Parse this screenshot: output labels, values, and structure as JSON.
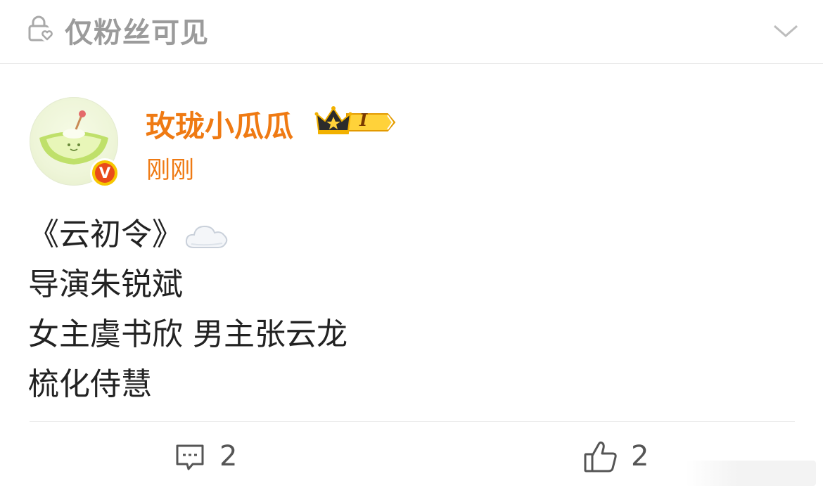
{
  "header": {
    "visibility_label": "仅粉丝可见",
    "lock_icon": "lock-heart-icon",
    "expand_icon": "chevron-down-icon"
  },
  "post": {
    "author": {
      "name": "玫珑小瓜瓜",
      "avatar_icon": "melon-avatar",
      "verified_icon": "verified-v-icon",
      "verified_mark": "V",
      "vip_icon": "crown-vip-icon",
      "vip_level": "I"
    },
    "time": "刚刚",
    "content_lines": [
      "《云初令》",
      "导演朱锐斌",
      "女主虞书欣 男主张云龙",
      "梳化侍慧"
    ],
    "emoji": "cloud-emoji"
  },
  "actions": {
    "comment_icon": "comment-icon",
    "comment_count": "2",
    "like_icon": "thumbs-up-icon",
    "like_count": "2"
  },
  "colors": {
    "accent": "#ef7a13",
    "muted": "#9b9b9b",
    "text": "#222222"
  }
}
